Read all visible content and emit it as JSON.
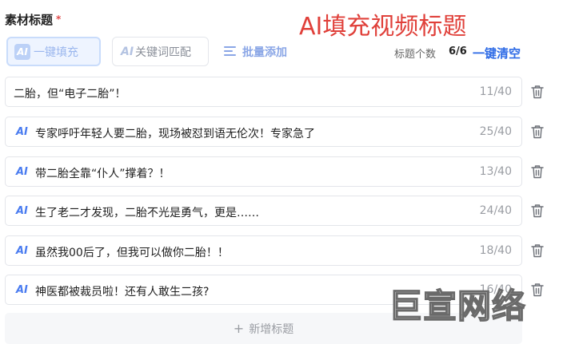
{
  "header": {
    "section_label": "素材标题",
    "required_mark": "*",
    "banner": "AI填充视频标题"
  },
  "toolbar": {
    "autofill_badge": "AI",
    "autofill_label": "一键填充",
    "keyword_badge": "AI",
    "keyword_label": "关键词匹配",
    "bulk_add_label": "批量添加",
    "count_label": "标题个数",
    "count_value": "6/6",
    "clear_all_label": "一键清空"
  },
  "titles": [
    {
      "ai": "",
      "text": "二胎，但“电子二胎”！",
      "count": "11/40"
    },
    {
      "ai": "AI",
      "text": "专家呼吁年轻人要二胎，现场被怼到语无伦次！专家急了",
      "count": "25/40"
    },
    {
      "ai": "AI",
      "text": "带二胎全靠“仆人”撑着？！",
      "count": "13/40"
    },
    {
      "ai": "AI",
      "text": "生了老二才发现，二胎不光是勇气，更是……",
      "count": "24/40"
    },
    {
      "ai": "AI",
      "text": "虽然我00后了，但我可以做你二胎！！",
      "count": "18/40"
    },
    {
      "ai": "AI",
      "text": "神医都被裁员啦！还有人敢生二孩?",
      "count": "16/40"
    }
  ],
  "add_title": {
    "icon": "+",
    "label": "新增标题"
  },
  "watermark": "巨宣网络",
  "colors": {
    "accent": "#2e6be6",
    "ai_tag": "#4a7cf0",
    "banner": "#e0403a",
    "required": "#e24c4c"
  }
}
